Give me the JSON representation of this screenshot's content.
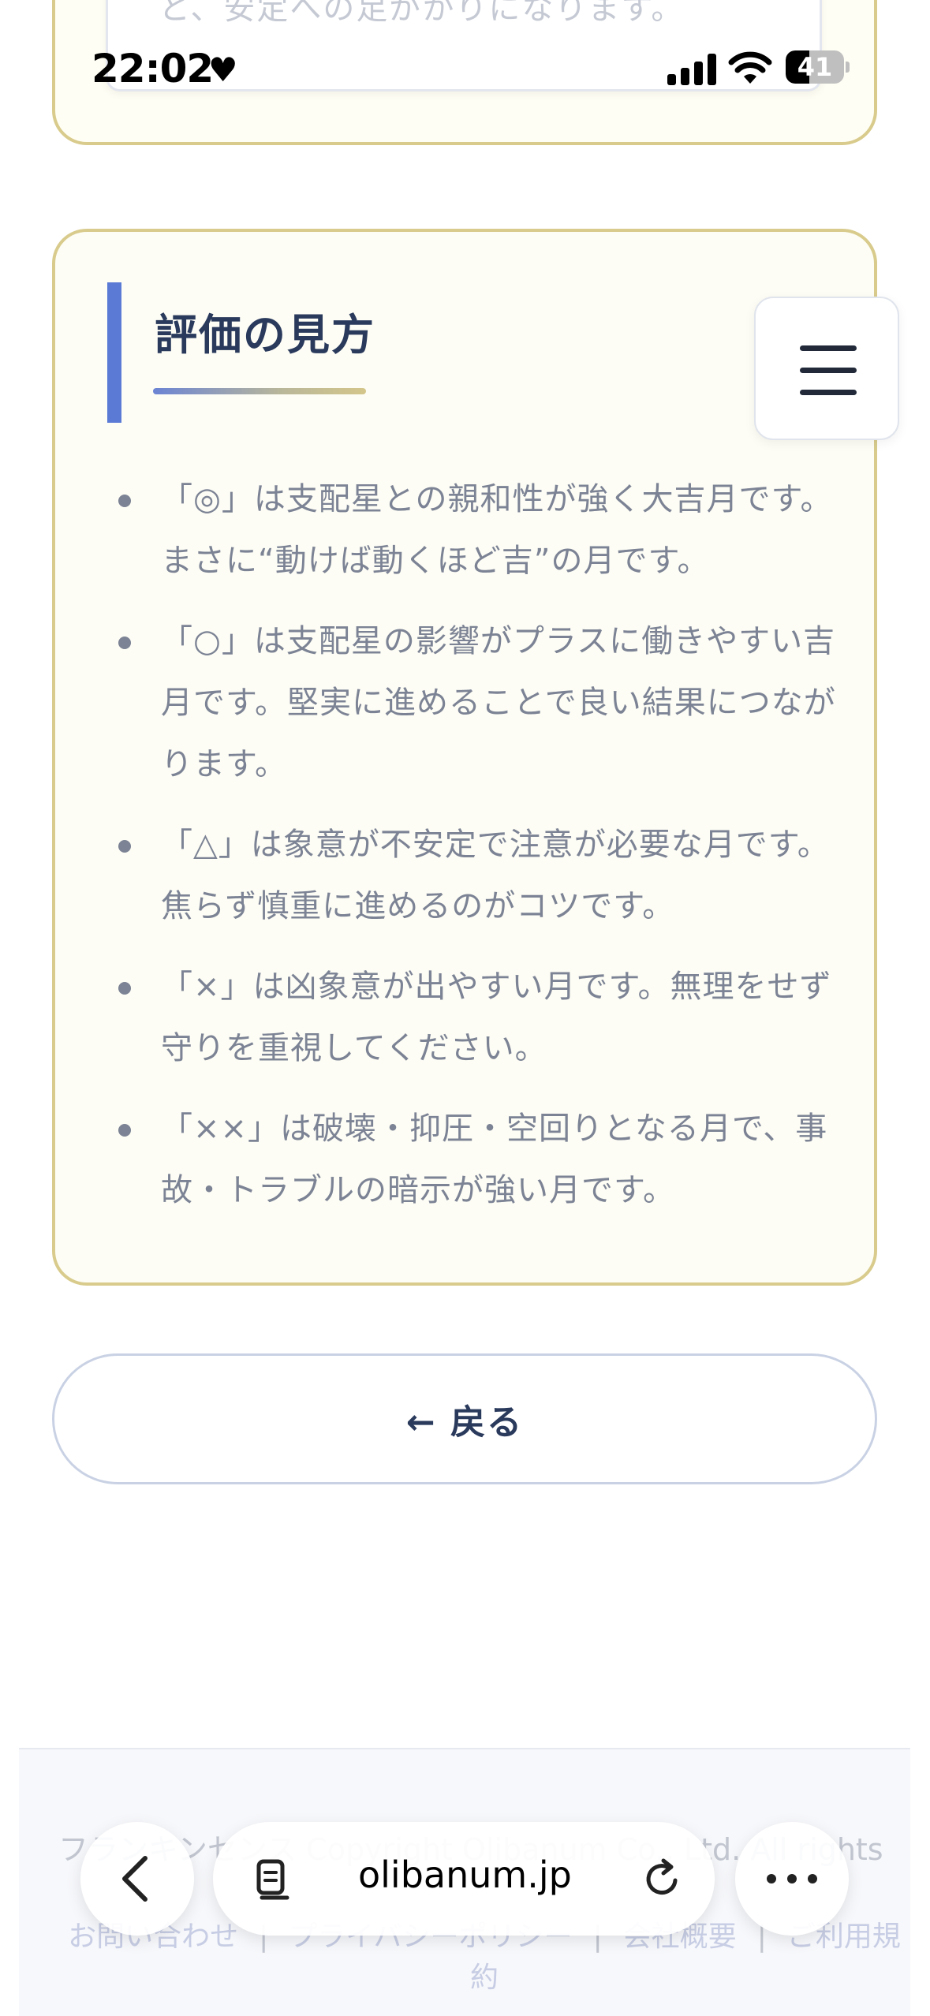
{
  "previous_card": {
    "partial_text": "と、安定への足がかりになります。"
  },
  "status_bar": {
    "time": "22:02",
    "battery": "41",
    "battery_level_percent": 41
  },
  "evaluation": {
    "title": "評価の見方",
    "items": [
      "「◎」は支配星との親和性が強く大吉月です。まさに“動けば動くほど吉”の月です。",
      "「○」は支配星の影響がプラスに働きやすい吉月です。堅実に進めることで良い結果につながります。",
      "「△」は象意が不安定で注意が必要な月です。焦らず慎重に進めるのがコツです。",
      "「×」は凶象意が出やすい月です。無理をせず守りを重視してください。",
      "「××」は破壊・抑圧・空回りとなる月で、事故・トラブルの暗示が強い月です。"
    ]
  },
  "back_button": {
    "label": "← 戻る"
  },
  "footer": {
    "copyright": "フランキンセンス Copyright Olibanum Co., Ltd. All rights",
    "links": [
      "お問い合わせ",
      "プライバシーポリシー",
      "会社概要",
      "ご利用規約"
    ],
    "separator": "|"
  },
  "browser": {
    "url": "olibanum.jp"
  },
  "icons": {
    "heart": "heart-icon",
    "signal": "cellular-signal-icon",
    "wifi": "wifi-icon",
    "battery": "battery-icon",
    "menu": "hamburger-menu-icon",
    "back": "chevron-left-icon",
    "tabs": "tabs-icon",
    "reload": "reload-icon",
    "more": "more-dots-icon"
  },
  "colors": {
    "card_border": "#d8cb8c",
    "card_background": "#fdfdf5",
    "accent_bar": "#5a7ad6",
    "title": "#2a3a5c",
    "body_text": "#7c8394"
  }
}
